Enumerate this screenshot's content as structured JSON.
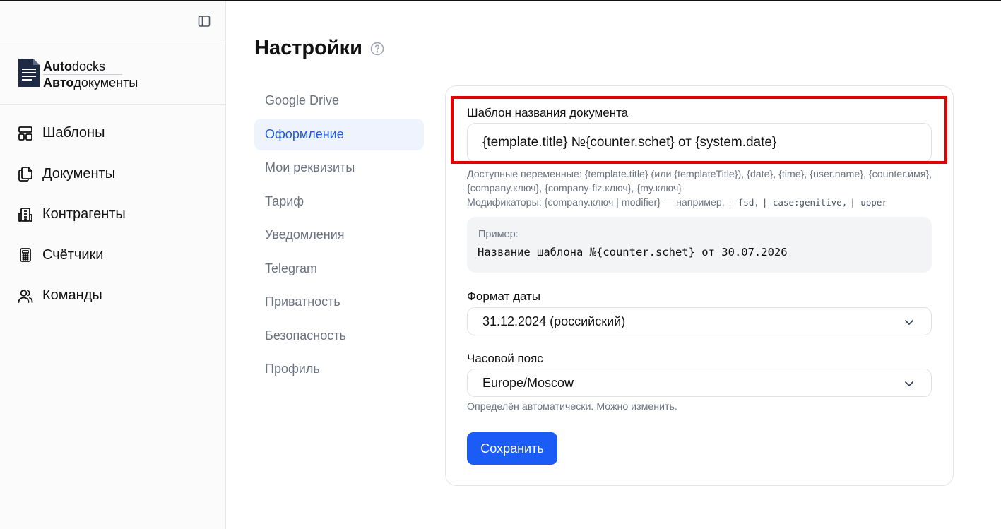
{
  "sidebar": {
    "brand": {
      "line1_bold": "Auto",
      "line1_rest": "docks",
      "line2_bold": "Авто",
      "line2_rest": "документы"
    },
    "items": [
      {
        "label": "Шаблоны",
        "icon": "layout-icon"
      },
      {
        "label": "Документы",
        "icon": "files-icon"
      },
      {
        "label": "Контрагенты",
        "icon": "building-icon"
      },
      {
        "label": "Счётчики",
        "icon": "calculator-icon"
      },
      {
        "label": "Команды",
        "icon": "users-icon"
      }
    ]
  },
  "header": {
    "title": "Настройки"
  },
  "settings_nav": {
    "items": [
      {
        "label": "Google Drive"
      },
      {
        "label": "Оформление"
      },
      {
        "label": "Мои реквизиты"
      },
      {
        "label": "Тариф"
      },
      {
        "label": "Уведомления"
      },
      {
        "label": "Telegram"
      },
      {
        "label": "Приватность"
      },
      {
        "label": "Безопасность"
      },
      {
        "label": "Профиль"
      }
    ],
    "active": "Оформление"
  },
  "form": {
    "template_label": "Шаблон названия документа",
    "template_value": "{template.title} №{counter.schet} от {system.date}",
    "vars_hint": "Доступные переменные: {template.title} (или {templateTitle}), {date}, {time}, {user.name}, {counter.имя}, {company.ключ}, {company-fiz.ключ}, {my.ключ}",
    "modifiers_prefix": "Модификаторы: {company.ключ | modifier} — например,",
    "modifiers": [
      "| fsd,",
      "| case:genitive,",
      "| upper"
    ],
    "example_label": "Пример:",
    "example_value": "Название шаблона №{counter.schet} от 30.07.2026",
    "date_format_label": "Формат даты",
    "date_format_value": "31.12.2024 (российский)",
    "timezone_label": "Часовой пояс",
    "timezone_value": "Europe/Moscow",
    "timezone_hint": "Определён автоматически. Можно изменить.",
    "save_label": "Сохранить"
  },
  "colors": {
    "accent": "#1a5cf5",
    "active_nav_bg": "#eef3fd",
    "active_nav_text": "#1d5bd8",
    "highlight": "#e50000"
  }
}
